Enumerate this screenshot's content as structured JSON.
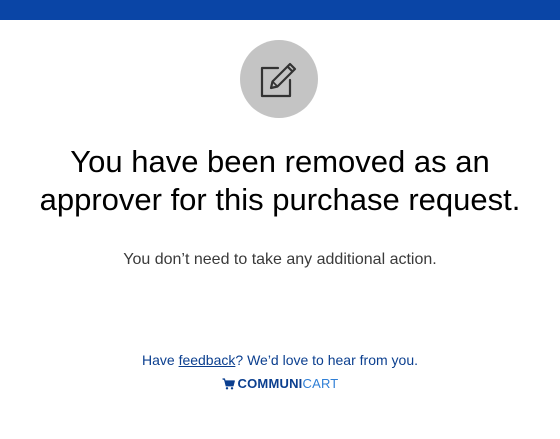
{
  "header": {
    "bar_color": "#0a45a6"
  },
  "status_icon": {
    "icon": "edit-icon",
    "bg_color": "#c4c4c4"
  },
  "message": {
    "headline_line1": "You have been removed as an",
    "headline_line2": "approver for this purchase request.",
    "subtext": "You don’t need to take any additional action."
  },
  "footer": {
    "feedback_prefix": "Have ",
    "feedback_link": "feedback",
    "feedback_suffix": "? We’d love to hear from you.",
    "brand_icon": "cart-icon",
    "brand_part1": "COMMUNI",
    "brand_part2": "CART",
    "brand_color_dark": "#0b3f8f",
    "brand_color_light": "#2f7fd6"
  }
}
